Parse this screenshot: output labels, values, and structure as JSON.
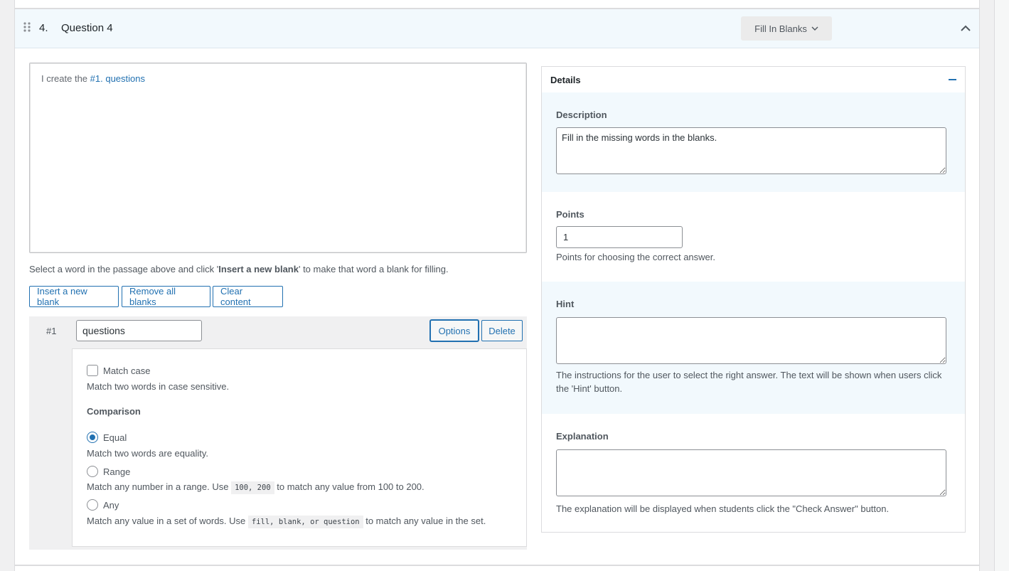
{
  "question": {
    "number": "4.",
    "title": "Question 4",
    "type_label": "Fill In Blanks"
  },
  "editor": {
    "text_before": "I create the ",
    "blank_token": "#1. questions"
  },
  "help_text_pre": "Select a word in the passage above and click '",
  "help_text_bold": "Insert a new blank",
  "help_text_post": "' to make that word a blank for filling.",
  "buttons": {
    "insert": "Insert a new blank",
    "remove_all": "Remove all blanks",
    "clear": "Clear content"
  },
  "blank": {
    "index": "#1",
    "value": "questions",
    "options_label": "Options",
    "delete_label": "Delete"
  },
  "options": {
    "match_case_label": "Match case",
    "match_case_checked": false,
    "match_case_desc": "Match two words in case sensitive.",
    "comparison_heading": "Comparison",
    "selected": "equal",
    "equal_label": "Equal",
    "equal_desc": "Match two words are equality.",
    "range_label": "Range",
    "range_desc_pre": "Match any number in a range. Use ",
    "range_code": "100, 200",
    "range_desc_post": " to match any value from 100 to 200.",
    "any_label": "Any",
    "any_desc_pre": "Match any value in a set of words. Use ",
    "any_code": "fill, blank, or question",
    "any_desc_post": " to match any value in the set."
  },
  "details": {
    "title": "Details",
    "description_label": "Description",
    "description_value": "Fill in the missing words in the blanks.",
    "points_label": "Points",
    "points_value": "1",
    "points_desc": "Points for choosing the correct answer.",
    "hint_label": "Hint",
    "hint_value": "",
    "hint_desc": "The instructions for the user to select the right answer. The text will be shown when users click the 'Hint' button.",
    "explanation_label": "Explanation",
    "explanation_value": "",
    "explanation_desc": "The explanation will be displayed when students click the \"Check Answer\" button."
  },
  "colors": {
    "accent": "#2271b1",
    "header_bg": "#f2f9fd",
    "blank_row_bg": "#f0f0f1"
  }
}
